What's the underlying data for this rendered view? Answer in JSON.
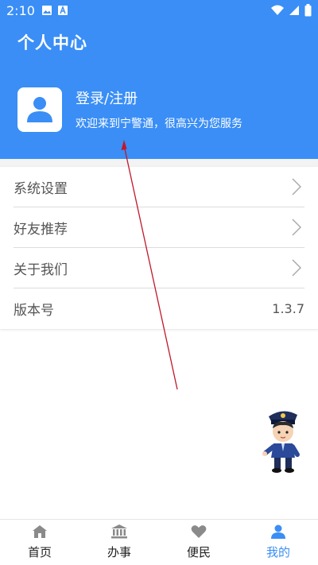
{
  "status_bar": {
    "time": "2:10"
  },
  "header": {
    "title": "个人中心",
    "login_label": "登录/注册",
    "welcome": "欢迎来到宁警通，很高兴为您服务"
  },
  "menu": {
    "items": [
      {
        "label": "系统设置"
      },
      {
        "label": "好友推荐"
      },
      {
        "label": "关于我们"
      },
      {
        "label": "版本号",
        "value": "1.3.7"
      }
    ]
  },
  "tabbar": {
    "tabs": [
      {
        "label": "首页",
        "icon": "home-icon"
      },
      {
        "label": "办事",
        "icon": "bank-icon"
      },
      {
        "label": "便民",
        "icon": "heart-icon"
      },
      {
        "label": "我的",
        "icon": "person-icon",
        "active": true
      }
    ]
  },
  "colors": {
    "primary": "#3a8ef6",
    "annotation": "#c0182a"
  }
}
